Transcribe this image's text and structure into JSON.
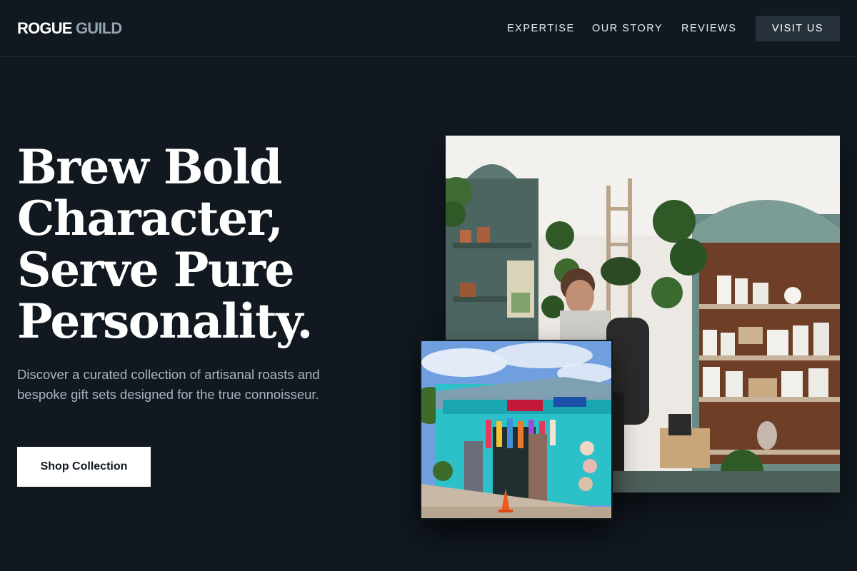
{
  "header": {
    "logo_primary": "ROGUE",
    "logo_secondary": "GUILD",
    "nav": [
      {
        "label": "EXPERTISE"
      },
      {
        "label": "OUR STORY"
      },
      {
        "label": "REVIEWS"
      }
    ],
    "cta_label": "VISIT US"
  },
  "hero": {
    "title_lines": [
      "Brew Bold",
      "Character,",
      "Serve Pure",
      "Personality."
    ],
    "description": "Discover a curated collection of artisanal roasts and bespoke gift sets designed for the true connoisseur.",
    "button_label": "Shop Collection"
  },
  "images": {
    "main_alt": "shop-interior-photo",
    "secondary_alt": "art-shop-storefront-photo"
  },
  "colors": {
    "background": "#111820",
    "accent_button": "#27313b",
    "muted_text": "#a9b5c1",
    "logo_secondary": "#94a3b1"
  }
}
